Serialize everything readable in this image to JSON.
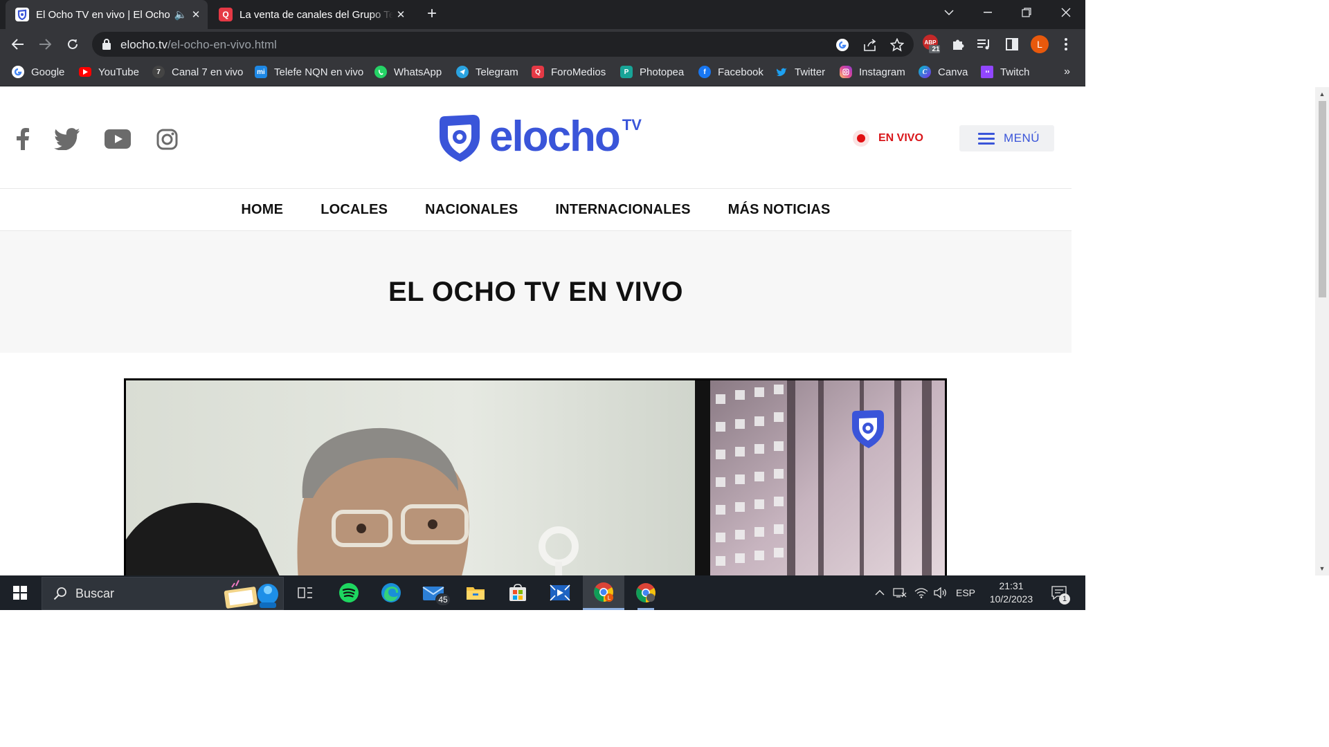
{
  "tabs": [
    {
      "title": "El Ocho TV en vivo | El Ocho",
      "active": true,
      "audio": true
    },
    {
      "title": "La venta de canales del Grupo Te",
      "active": false,
      "audio": false
    }
  ],
  "toolbar": {
    "url_domain": "elocho.tv",
    "url_path": "/el-ocho-en-vivo.html",
    "extension_badge": "21",
    "profile_initial": "L"
  },
  "bookmarks": [
    {
      "label": "Google",
      "icon": "google-icon",
      "color": "#ffffff"
    },
    {
      "label": "YouTube",
      "icon": "youtube-icon",
      "color": "#ff0000"
    },
    {
      "label": "Canal 7 en vivo",
      "icon": "canal7-icon",
      "color": "#444444"
    },
    {
      "label": "Telefe NQN en vivo",
      "icon": "telefe-icon",
      "color": "#1e88e5"
    },
    {
      "label": "WhatsApp",
      "icon": "whatsapp-icon",
      "color": "#25d366"
    },
    {
      "label": "Telegram",
      "icon": "telegram-icon",
      "color": "#2aa3e0"
    },
    {
      "label": "ForoMedios",
      "icon": "foromedios-icon",
      "color": "#e53935"
    },
    {
      "label": "Photopea",
      "icon": "photopea-icon",
      "color": "#18a497"
    },
    {
      "label": "Facebook",
      "icon": "facebook-icon",
      "color": "#1877f2"
    },
    {
      "label": "Twitter",
      "icon": "twitter-icon",
      "color": "#1da1f2"
    },
    {
      "label": "Instagram",
      "icon": "instagram-icon",
      "color": "#d6249f"
    },
    {
      "label": "Canva",
      "icon": "canva-icon",
      "color": "#00c4cc"
    },
    {
      "label": "Twitch",
      "icon": "twitch-icon",
      "color": "#9146ff"
    }
  ],
  "site": {
    "logo_text": "elocho",
    "logo_sup": "TV",
    "live_label": "EN VIVO",
    "menu_label": "MENÚ",
    "nav": [
      "HOME",
      "LOCALES",
      "NACIONALES",
      "INTERNACIONALES",
      "MÁS NOTICIAS"
    ],
    "page_title": "EL OCHO TV EN VIVO",
    "brand_color": "#3a55d9",
    "live_color": "#d9161a"
  },
  "taskbar": {
    "search_placeholder": "Buscar",
    "mail_badge": "45",
    "language": "ESP",
    "time": "21:31",
    "date": "10/2/2023",
    "notifications": "1"
  }
}
